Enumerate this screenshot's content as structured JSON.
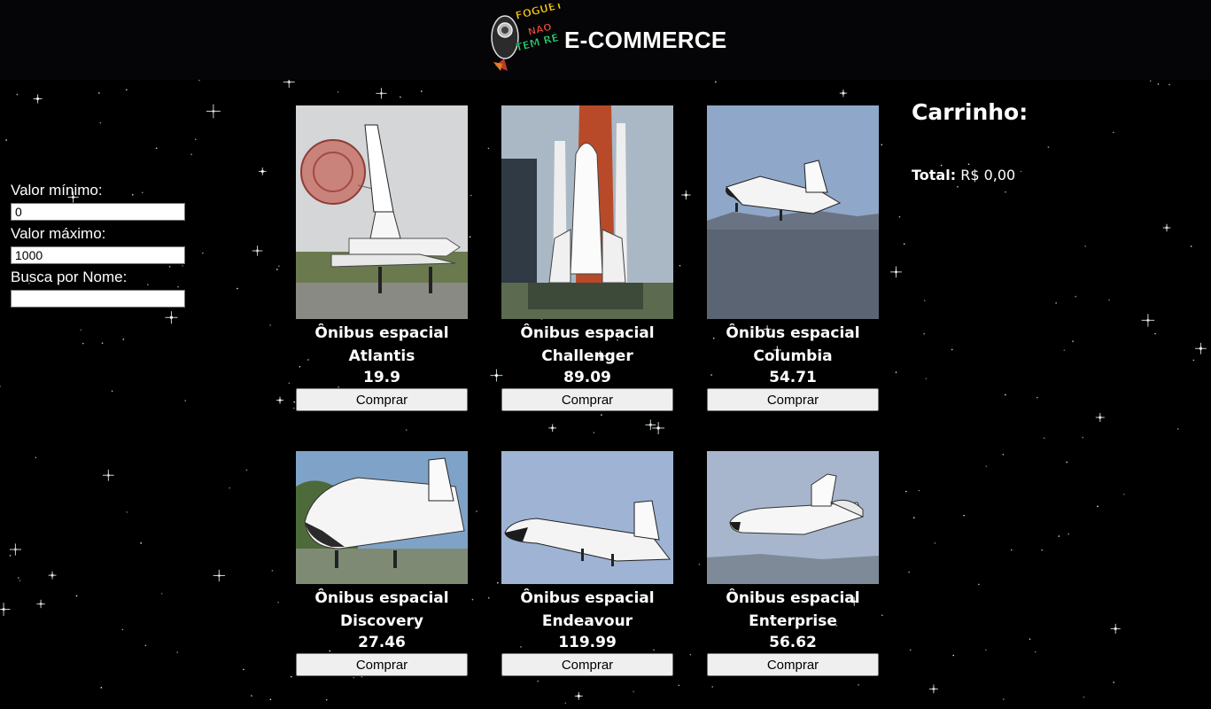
{
  "header": {
    "logo_text": [
      "FOGUETE",
      "NÃO",
      "TEM RÉ"
    ],
    "title": "E-COMMERCE"
  },
  "filters": {
    "min_label": "Valor mínimo:",
    "min_value": "0",
    "max_label": "Valor máximo:",
    "max_value": "1000",
    "name_label": "Busca por Nome:",
    "name_value": ""
  },
  "products": [
    {
      "name_line1": "Ônibus espacial",
      "name_line2": "Atlantis",
      "price": "19.9",
      "button": "Comprar",
      "image": "shuttle-landing-parachute"
    },
    {
      "name_line1": "Ônibus espacial",
      "name_line2": "Challenger",
      "price": "89.09",
      "button": "Comprar",
      "image": "shuttle-launch-pad"
    },
    {
      "name_line1": "Ônibus espacial",
      "name_line2": "Columbia",
      "price": "54.71",
      "button": "Comprar",
      "image": "shuttle-landing-approach"
    },
    {
      "name_line1": "Ônibus espacial",
      "name_line2": "Discovery",
      "price": "27.46",
      "button": "Comprar",
      "image": "shuttle-on-ground"
    },
    {
      "name_line1": "Ônibus espacial",
      "name_line2": "Endeavour",
      "price": "119.99",
      "button": "Comprar",
      "image": "shuttle-in-flight"
    },
    {
      "name_line1": "Ônibus espacial",
      "name_line2": "Enterprise",
      "price": "56.62",
      "button": "Comprar",
      "image": "shuttle-free-flight"
    }
  ],
  "cart": {
    "title": "Carrinho:",
    "total_label": "Total:",
    "total_value": "R$ 0,00"
  },
  "colors": {
    "background": "#000000",
    "header_background": "#050508",
    "text": "#ffffff",
    "button": "#efefef"
  }
}
